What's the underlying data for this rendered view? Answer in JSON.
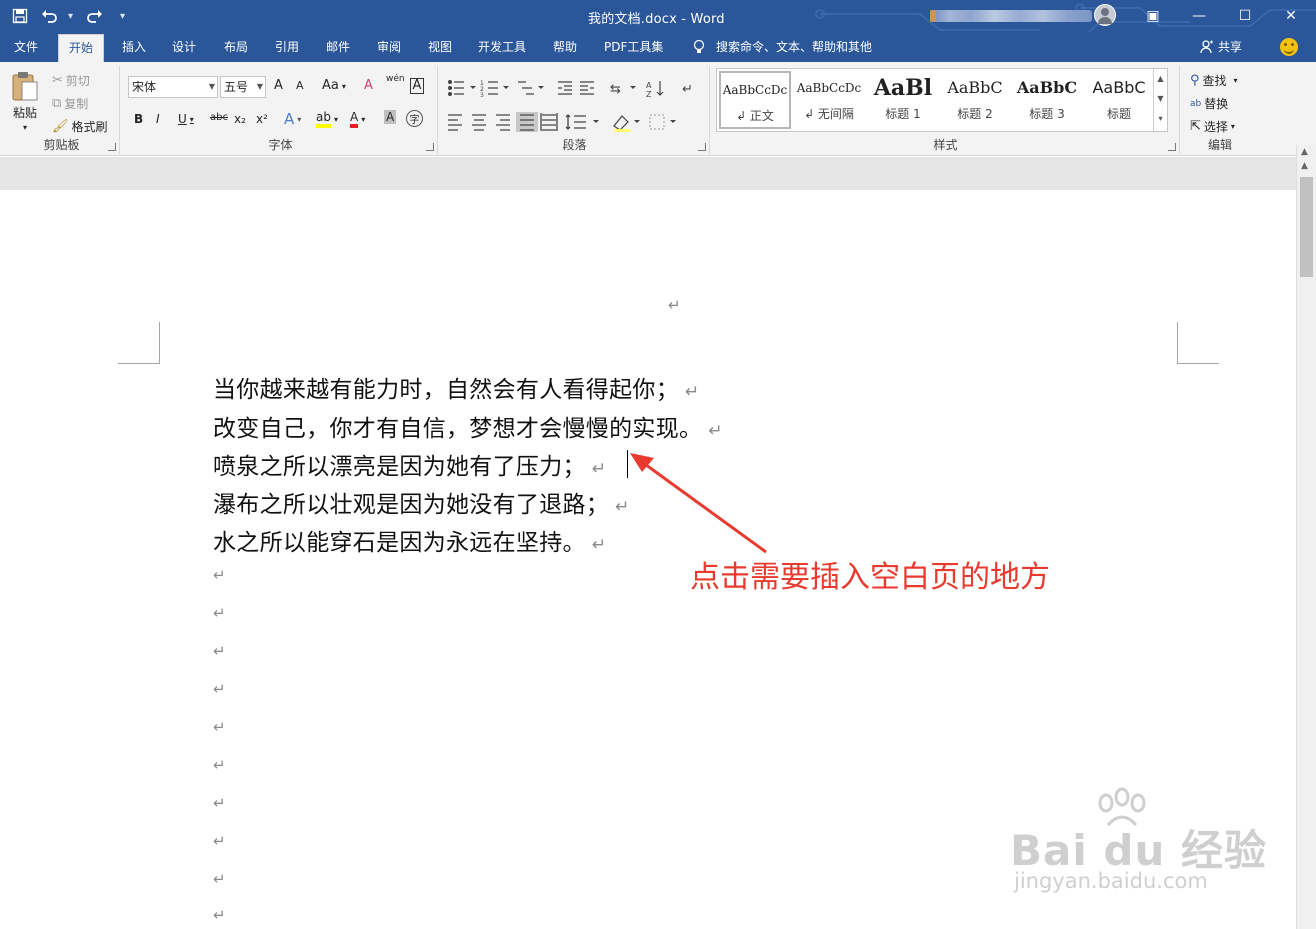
{
  "window": {
    "title": "我的文档.docx  -  Word",
    "controls": {
      "restore_ribbon": "▣",
      "minimize": "—",
      "maximize": "☐",
      "close": "✕"
    }
  },
  "qat": {
    "save_icon": "save-icon",
    "undo_icon": "undo-icon",
    "redo_icon": "redo-icon",
    "customize": "▾"
  },
  "tabs": [
    "文件",
    "开始",
    "插入",
    "设计",
    "布局",
    "引用",
    "邮件",
    "审阅",
    "视图",
    "开发工具",
    "帮助",
    "PDF工具集"
  ],
  "active_tab": "开始",
  "tell_me": "搜索命令、文本、帮助和其他",
  "share": "共享",
  "ribbon": {
    "clipboard": {
      "paste": "粘贴",
      "cut": "剪切",
      "copy": "复制",
      "format_painter": "格式刷",
      "label": "剪贴板"
    },
    "font": {
      "font_name": "宋体",
      "font_size": "五号",
      "label": "字体",
      "grow": "A",
      "shrink": "A",
      "case": "Aa",
      "clear": "A",
      "phonetic": "wén",
      "border": "A",
      "bold": "B",
      "italic": "I",
      "underline": "U",
      "strike": "abc",
      "sub": "x₂",
      "sup": "x²",
      "effects": "A",
      "highlight": "ab",
      "font_color": "A",
      "shading": "A",
      "enclose": "字"
    },
    "paragraph": {
      "label": "段落"
    },
    "styles": {
      "label": "样式",
      "items": [
        {
          "preview": "AaBbCcDc",
          "name": "↲ 正文"
        },
        {
          "preview": "AaBbCcDc",
          "name": "↲ 无间隔"
        },
        {
          "preview": "AaBl",
          "name": "标题 1"
        },
        {
          "preview": "AaBbC",
          "name": "标题 2"
        },
        {
          "preview": "AaBbC",
          "name": "标题 3"
        },
        {
          "preview": "AaBbC",
          "name": "标题"
        }
      ]
    },
    "editing": {
      "find": "查找",
      "replace": "替换",
      "select": "选择",
      "label": "编辑"
    }
  },
  "document": {
    "empty_para": "↵",
    "lines": [
      "当你越来越有能力时，自然会有人看得起你；",
      "改变自己，你才有自信，梦想才会慢慢的实现。",
      "喷泉之所以漂亮是因为她有了压力；",
      "瀑布之所以壮观是因为她没有了退路；",
      "水之所以能穿石是因为永远在坚持。"
    ],
    "para_mark": "↵"
  },
  "annotation": {
    "text": "点击需要插入空白页的地方",
    "color": "#e83a2e"
  },
  "watermark": {
    "brand": "Bai du 经验",
    "url": "jingyan.baidu.com"
  },
  "colors": {
    "accent": "#2b579a",
    "ribbon_bg": "#f3f3f3",
    "gutter": "#e6e6e6"
  }
}
